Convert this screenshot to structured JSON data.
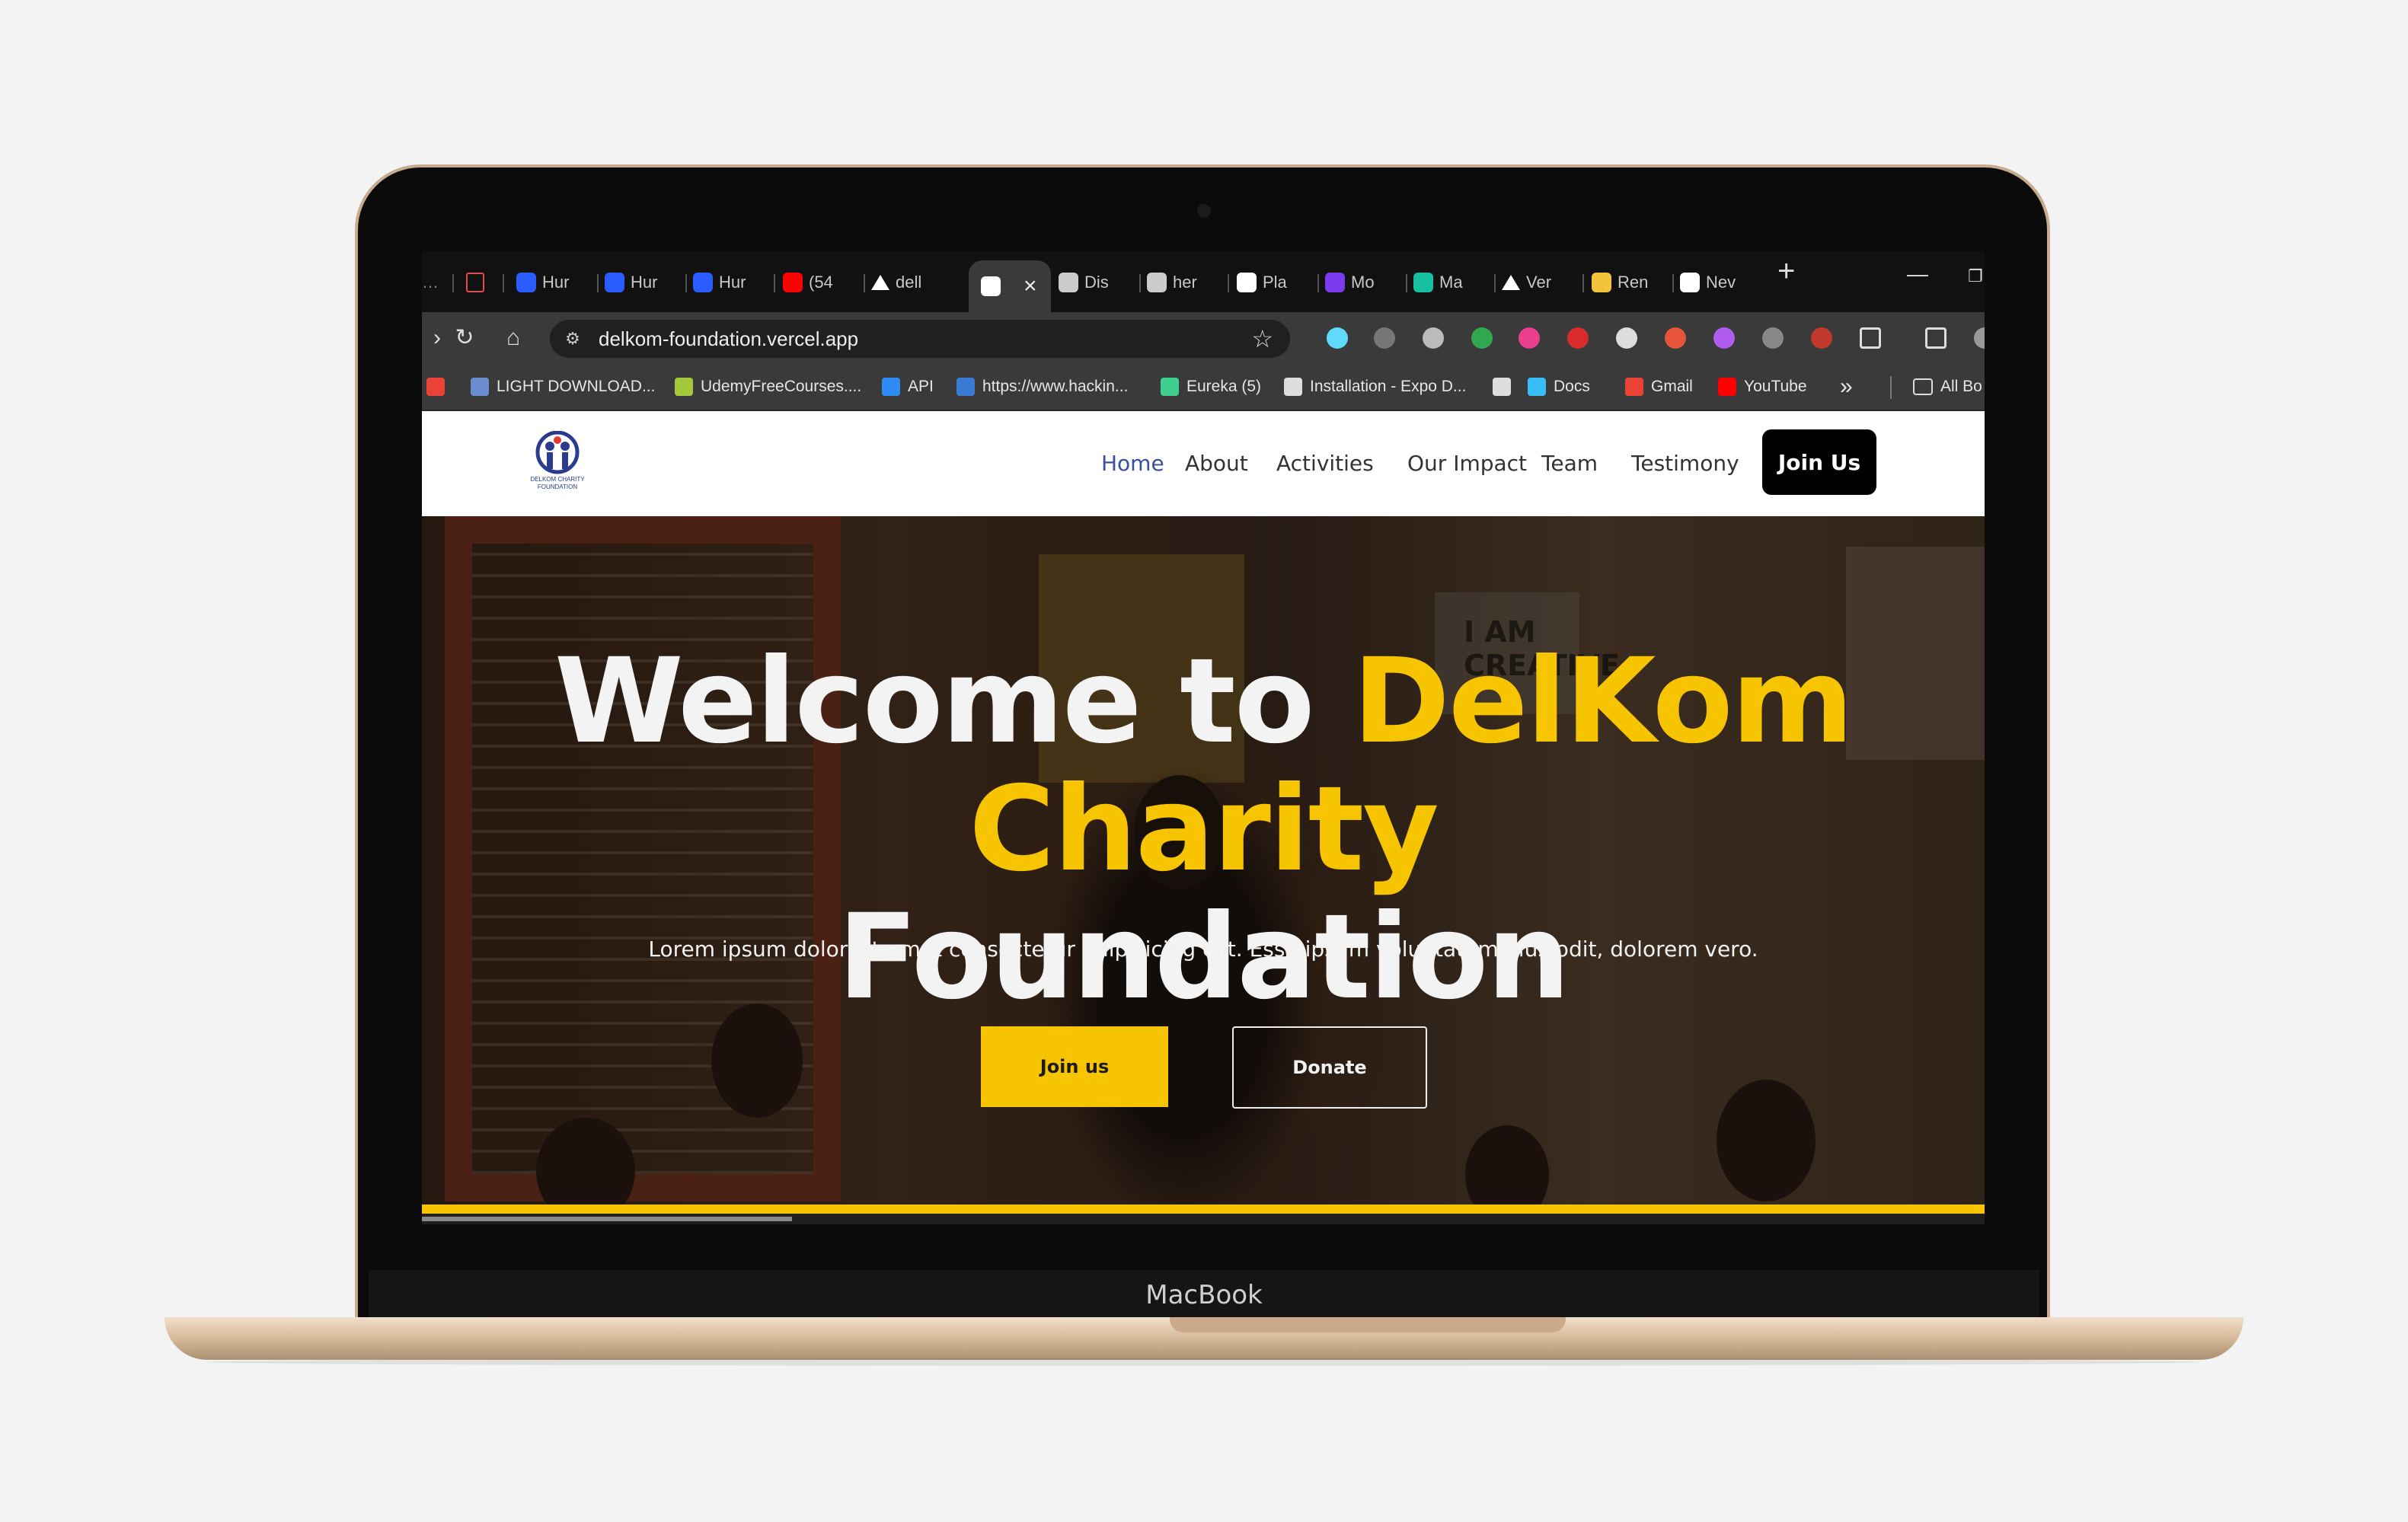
{
  "device": {
    "label": "MacBook"
  },
  "browser": {
    "tabs": [
      {
        "label": "Hur",
        "icon": "search-icon",
        "color": "#2b5cff"
      },
      {
        "label": "Hur",
        "icon": "search-icon",
        "color": "#2b5cff"
      },
      {
        "label": "Hur",
        "icon": "search-icon",
        "color": "#2b5cff"
      },
      {
        "label": "(54",
        "icon": "youtube-icon",
        "color": "#ff0000"
      },
      {
        "label": "dell",
        "icon": "vercel-icon",
        "color": "#ffffff"
      },
      {
        "label": "",
        "icon": "delkom-favicon-icon",
        "color": "#ffffff"
      },
      {
        "label": "Dis",
        "icon": "globe-icon",
        "color": "#cccccc"
      },
      {
        "label": "her",
        "icon": "globe-icon",
        "color": "#cccccc"
      },
      {
        "label": "Pla",
        "icon": "google-icon",
        "color": "#ffffff"
      },
      {
        "label": "Mo",
        "icon": "purple-app-icon",
        "color": "#7c3aed"
      },
      {
        "label": "Ma",
        "icon": "robot-icon",
        "color": "#16c0a0"
      },
      {
        "label": "Ver",
        "icon": "vercel-icon",
        "color": "#ffffff"
      },
      {
        "label": "Ren",
        "icon": "render-icon",
        "color": "#f3c33c"
      },
      {
        "label": "Nev",
        "icon": "chrome-icon",
        "color": "#ffffff"
      }
    ],
    "url": "delkom-foundation.vercel.app",
    "bookmarks": [
      {
        "label": "",
        "icon": "gmail-icon",
        "color": "#ea4335"
      },
      {
        "label": "LIGHT DOWNLOAD...",
        "icon": "download-site-icon",
        "color": "#6c8ed0"
      },
      {
        "label": "UdemyFreeCourses....",
        "icon": "udemy-icon",
        "color": "#a3c93a"
      },
      {
        "label": "API",
        "icon": "vscode-icon",
        "color": "#2f8cf5"
      },
      {
        "label": "https://www.hackin...",
        "icon": "globe-icon",
        "color": "#3a7bd5"
      },
      {
        "label": "Eureka (5)",
        "icon": "eureka-icon",
        "color": "#3ecf8e"
      },
      {
        "label": "Installation - Expo D...",
        "icon": "expo-icon",
        "color": "#dddddd"
      },
      {
        "label": "",
        "icon": "globe-icon",
        "color": "#dddddd"
      },
      {
        "label": "Docs",
        "icon": "tailwind-icon",
        "color": "#38bdf8"
      },
      {
        "label": "Gmail",
        "icon": "gmail-icon",
        "color": "#ea4335"
      },
      {
        "label": "YouTube",
        "icon": "youtube-icon",
        "color": "#ff0000"
      },
      {
        "label": "»",
        "icon": "chevron-double-right-icon",
        "color": "#dddddd"
      },
      {
        "label": "All Bo",
        "icon": "folder-icon",
        "color": "#dddddd"
      }
    ]
  },
  "site": {
    "nav": {
      "logo_label": "DELKOM CHARITY FOUNDATION",
      "links": [
        "Home",
        "About",
        "Activities",
        "Our Impact",
        "Team",
        "Testimony"
      ],
      "active": "Home",
      "cta": "Join Us"
    },
    "hero": {
      "title_prefix": "Welcome to ",
      "title_highlight": "DelKom Charity",
      "title_suffix": "Foundation",
      "poster_text": "I AM CREATIVE",
      "subtitle": "Lorem ipsum dolor sit amet consectetur adipisicing elit. Esse ipsam voluptatem eius odit, dolorem vero.",
      "primary_button": "Join us",
      "secondary_button": "Donate"
    }
  },
  "colors": {
    "accent": "#f6c400",
    "nav_active": "#3a4fa0",
    "cta_bg": "#000000"
  }
}
